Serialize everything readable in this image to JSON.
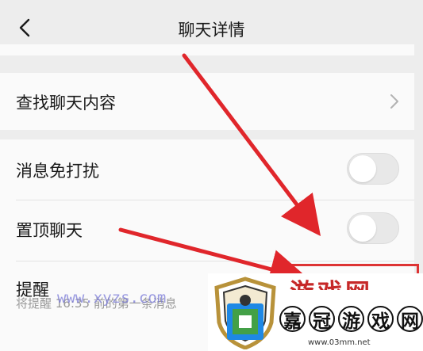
{
  "header": {
    "title": "聊天详情",
    "back_icon": "chevron-left-icon"
  },
  "rows": {
    "find": {
      "label": "查找聊天内容",
      "icon": "chevron-right-icon"
    },
    "mute": {
      "label": "消息免打扰",
      "on": false
    },
    "pin": {
      "label": "置顶聊天",
      "on": false
    },
    "reminder": {
      "label": "提醒",
      "subtext": "将提醒 16:35 前的第一条消息"
    }
  },
  "watermark": {
    "url": "www.xyzs.com",
    "brand_top": "游戏网",
    "brand_chars": [
      "嘉",
      "冠",
      "游",
      "戏",
      "网"
    ],
    "site": "www.03mm.net"
  },
  "colors": {
    "accent": "#d33333",
    "background": "#ededed",
    "card": "#fafafa",
    "watermark_text": "#7a7ad8"
  }
}
